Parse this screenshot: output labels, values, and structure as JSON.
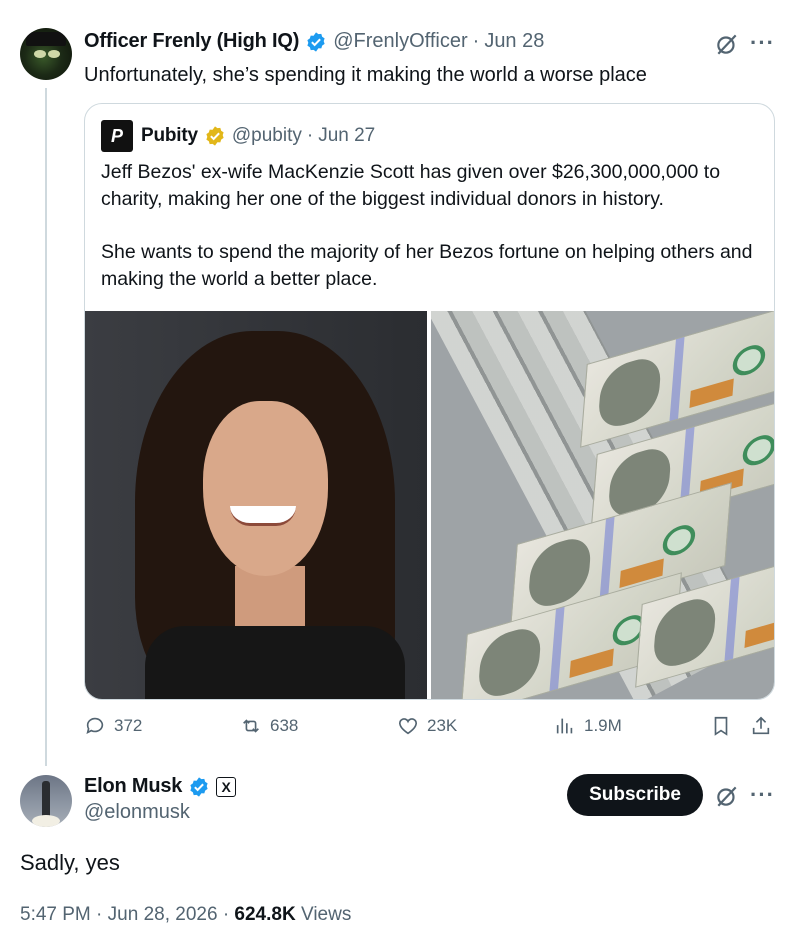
{
  "colors": {
    "text": "#0f1419",
    "muted": "#536471",
    "border": "#cfd9de",
    "verified_blue": "#1d9bf0",
    "verified_gold": "#e2b719",
    "button": "#0f1419"
  },
  "parent": {
    "author_name": "Officer Frenly (High IQ)",
    "handle": "@FrenlyOfficer",
    "separator": "·",
    "date": "Jun 28",
    "text": "Unfortunately, she’s spending it making the world a worse place",
    "quote": {
      "logo_letter": "P",
      "author_name": "Pubity",
      "handle": "@pubity",
      "separator": "·",
      "date": "Jun 27",
      "paragraphs": [
        "Jeff Bezos' ex-wife MacKenzie Scott has given over $26,300,000,000 to charity, making her one of the biggest individual donors in history.",
        "She wants to spend the majority of her Bezos fortune on helping others and making the world a better place."
      ]
    },
    "stats": {
      "replies": "372",
      "reposts": "638",
      "likes": "23K",
      "views": "1.9M"
    }
  },
  "main": {
    "author_name": "Elon Musk",
    "affiliate_badge": "X",
    "handle": "@elonmusk",
    "subscribe_label": "Subscribe",
    "text": "Sadly, yes",
    "time": "5:47 PM",
    "separator": "·",
    "date": "Jun 28, 2026",
    "views_count": "624.8K",
    "views_label": "Views"
  },
  "icons": [
    "reply-icon",
    "repost-icon",
    "like-icon",
    "views-icon",
    "bookmark-icon",
    "share-icon",
    "grok-icon",
    "more-icon",
    "verified-icon"
  ]
}
